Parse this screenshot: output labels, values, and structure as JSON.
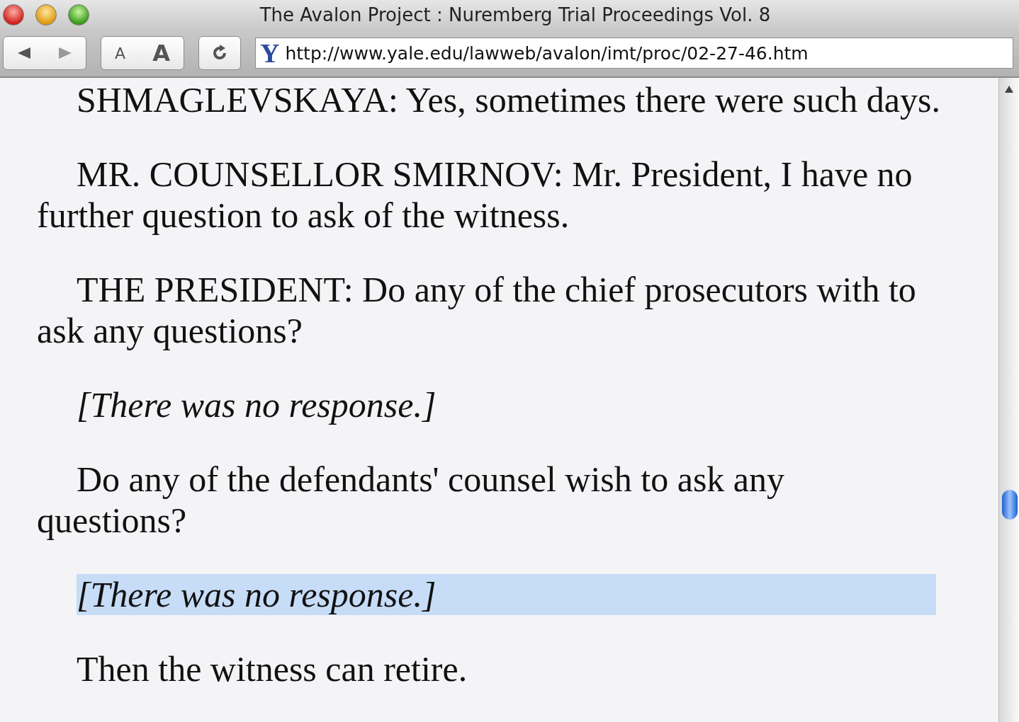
{
  "window": {
    "title": "The Avalon Project : Nuremberg Trial Proceedings Vol. 8"
  },
  "toolbar": {
    "text_smaller": "A",
    "text_bigger": "A",
    "favicon": "Y",
    "address": "http://www.yale.edu/lawweb/avalon/imt/proc/02-27-46.htm"
  },
  "paragraphs": [
    {
      "kind": "speech",
      "text": "SHMAGLEVSKAYA: Yes, sometimes there were such days.",
      "selected": false
    },
    {
      "kind": "speech",
      "text": "MR. COUNSELLOR SMIRNOV: Mr. President, I have no further question to ask of the witness.",
      "selected": false
    },
    {
      "kind": "speech",
      "text": "THE PRESIDENT: Do any of the chief prosecutors with to ask any questions?",
      "selected": false
    },
    {
      "kind": "note",
      "text": "[There was no response.]",
      "selected": false
    },
    {
      "kind": "speech",
      "text": "Do any of the defendants' counsel wish to ask any questions?",
      "selected": false
    },
    {
      "kind": "note",
      "text": "[There was no response.]",
      "selected": true
    },
    {
      "kind": "speech",
      "text": "Then the witness can retire.",
      "selected": false
    }
  ]
}
